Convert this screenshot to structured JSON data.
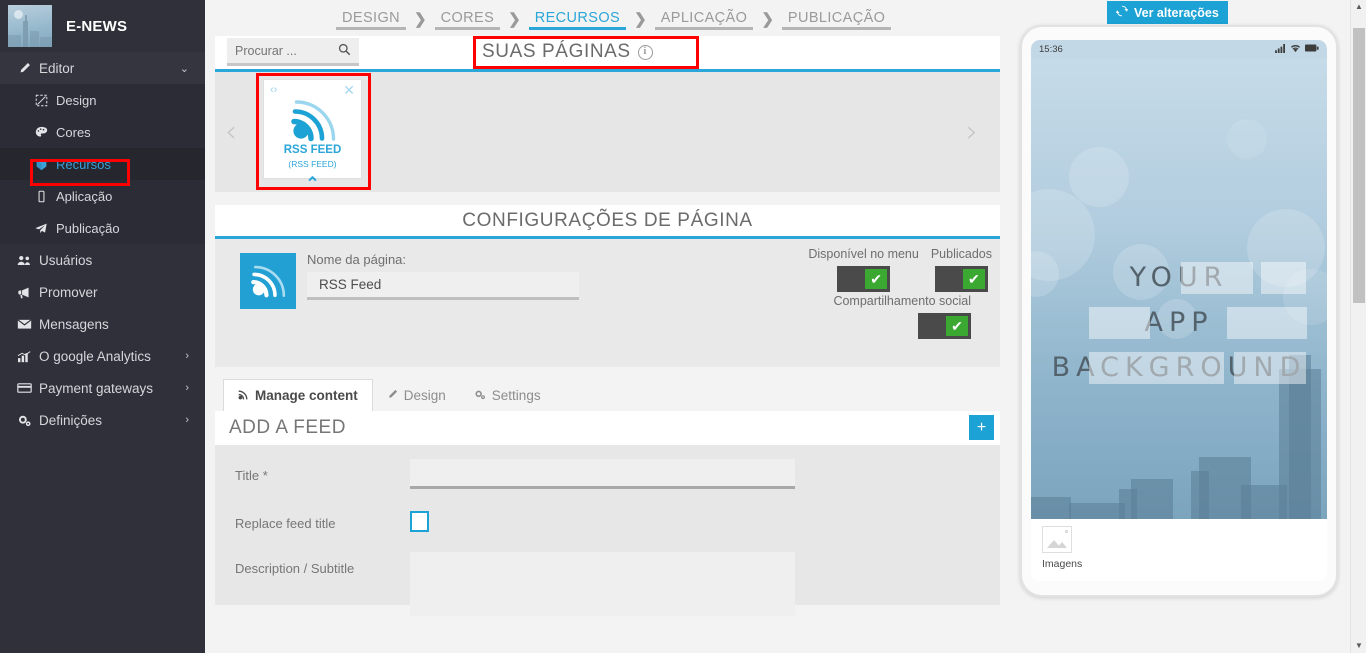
{
  "sidebar": {
    "brand": {
      "name": "E-NEWS",
      "logo_icon": "city-skyline-thumbnail"
    },
    "editor": {
      "label": "Editor",
      "icon": "pencil-icon",
      "caret": "chevron-down-icon"
    },
    "sub_items": [
      {
        "label": "Design",
        "icon": "design-frame-icon"
      },
      {
        "label": "Cores",
        "icon": "palette-icon"
      },
      {
        "label": "Recursos",
        "icon": "box-icon",
        "active": true
      },
      {
        "label": "Aplicação",
        "icon": "mobile-icon"
      },
      {
        "label": "Publicação",
        "icon": "paper-plane-icon"
      }
    ],
    "items": [
      {
        "label": "Usuários",
        "icon": "users-icon",
        "caret": ""
      },
      {
        "label": "Promover",
        "icon": "megaphone-icon",
        "caret": ""
      },
      {
        "label": "Mensagens",
        "icon": "envelope-icon",
        "caret": ""
      },
      {
        "label": "O google Analytics",
        "icon": "bar-chart-icon",
        "caret": "›"
      },
      {
        "label": "Payment gateways",
        "icon": "credit-card-icon",
        "caret": "›"
      },
      {
        "label": "Definições",
        "icon": "gears-icon",
        "caret": "›"
      }
    ]
  },
  "breadcrumb": {
    "items": [
      {
        "label": "DESIGN",
        "active": false
      },
      {
        "label": "CORES",
        "active": false
      },
      {
        "label": "RECURSOS",
        "active": true
      },
      {
        "label": "APLICAÇÃO",
        "active": false
      },
      {
        "label": "PUBLICAÇÃO",
        "active": false
      }
    ],
    "separator": "❯"
  },
  "pages_panel": {
    "search_placeholder": "Procurar ...",
    "search_value": "",
    "search_icon": "magnifier-icon",
    "title": "SUAS PÁGINAS",
    "info_icon": "i",
    "arrow_left": "‹",
    "arrow_right": "›",
    "feature_card": {
      "code_icon": "‹›",
      "close_icon": "✕",
      "icon": "rss-feed-icon",
      "label": "RSS FEED",
      "sublabel": "(RSS FEED)",
      "chevron": "⌃"
    }
  },
  "config": {
    "title": "CONFIGURAÇÕES DE PÁGINA",
    "page_icon": "rss-feed-icon",
    "name_label": "Nome da página:",
    "name_value": "RSS Feed",
    "toggles": [
      {
        "label": "Disponível no menu",
        "checked": true,
        "check_glyph": "✔"
      },
      {
        "label": "Publicados",
        "checked": true,
        "check_glyph": "✔"
      },
      {
        "label": "Compartilhamento social",
        "checked": true,
        "check_glyph": "✔"
      }
    ]
  },
  "tabs": [
    {
      "label": "Manage content",
      "icon": "rss-icon",
      "active": true
    },
    {
      "label": "Design",
      "icon": "pencil-icon",
      "active": false
    },
    {
      "label": "Settings",
      "icon": "gears-icon",
      "active": false
    }
  ],
  "add_feed": {
    "title": "ADD A FEED",
    "plus_icon": "+",
    "fields": [
      {
        "label": "Title *",
        "type": "text",
        "value": "",
        "placeholder": ""
      },
      {
        "label": "Replace feed title",
        "type": "checkbox",
        "checked": false
      },
      {
        "label": "Description / Subtitle",
        "type": "textarea",
        "value": "",
        "placeholder": ""
      }
    ]
  },
  "preview": {
    "refresh_button": {
      "label": "Ver alterações",
      "icon": "refresh-icon"
    },
    "status_bar": {
      "time": "15:36",
      "signal_icon": "cellular-signal-icon",
      "wifi_icon": "wifi-icon",
      "battery_icon": "battery-icon"
    },
    "background_text": [
      "YOUR",
      "APP",
      "BACKGROUND"
    ],
    "tray": {
      "icon": "image-placeholder-icon",
      "label": "Imagens"
    }
  },
  "scrollbar": {
    "up_arrow": "▲",
    "down_arrow": "▼"
  },
  "colors": {
    "accent": "#2ba6d8",
    "sidebar_bg": "#2f3039",
    "highlight_red": "#ff0000",
    "toggle_on": "#3ba832",
    "toggle_track": "#4a4a4a"
  }
}
